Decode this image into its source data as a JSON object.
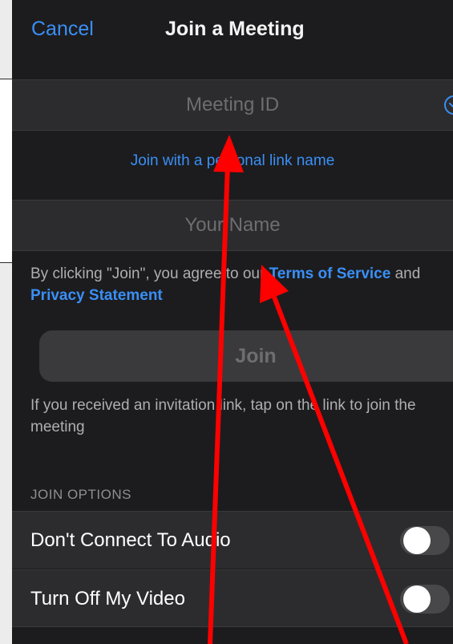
{
  "nav": {
    "cancel_label": "Cancel",
    "title": "Join a Meeting"
  },
  "meeting_id": {
    "placeholder": "Meeting ID",
    "value": ""
  },
  "personal_link_label": "Join with a personal link name",
  "your_name": {
    "placeholder": "Your Name",
    "value": ""
  },
  "terms": {
    "prefix": "By clicking \"Join\", you agree to our ",
    "terms_link": "Terms of Service",
    "middle": " and ",
    "privacy_link": "Privacy Statement"
  },
  "join_label": "Join",
  "invite_hint": "If you received an invitation link, tap on the link to join the meeting",
  "join_options": {
    "header": "JOIN OPTIONS",
    "items": [
      {
        "label": "Don't Connect To Audio",
        "enabled": false
      },
      {
        "label": "Turn Off My Video",
        "enabled": false
      }
    ]
  },
  "icons": {
    "chevron": "chevron-down-circle-icon"
  },
  "colors": {
    "accent": "#3a8ff5",
    "background": "#1c1c1e",
    "field": "#2c2c2e",
    "annotation_arrow": "#ff0000"
  }
}
